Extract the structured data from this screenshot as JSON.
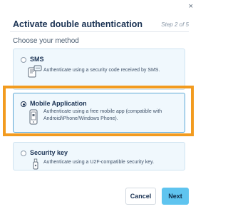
{
  "dialog": {
    "close_label": "×",
    "title": "Activate double authentication",
    "step": "Step 2 of 5",
    "subtitle": "Choose your method"
  },
  "methods": [
    {
      "name": "SMS",
      "description": "Authenticate using a security code received by SMS.",
      "icon": "sms-phone-icon",
      "selected": false
    },
    {
      "name": "Mobile Application",
      "description": "Authenticate using a free mobile app (compatible with Android/iPhone/Windows Phone).",
      "icon": "mobile-app-icon",
      "selected": true
    },
    {
      "name": "Security key",
      "description": "Authenticate using a U2F-compatible security key.",
      "icon": "usb-key-icon",
      "selected": false
    }
  ],
  "buttons": {
    "cancel": "Cancel",
    "next": "Next"
  },
  "colors": {
    "accent": "#5fc4ef",
    "highlight": "#f29b1f",
    "card_bg": "#f0f8fd",
    "title": "#1a3253"
  }
}
